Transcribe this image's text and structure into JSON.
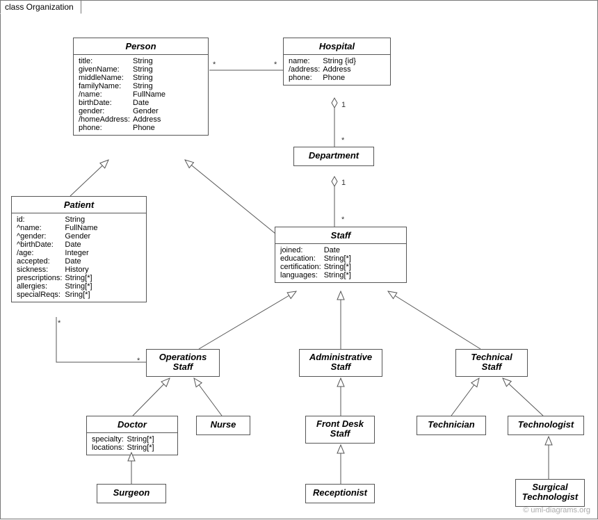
{
  "diagram_title": "class Organization",
  "watermark": "© uml-diagrams.org",
  "classes": {
    "person": {
      "name": "Person",
      "attrs": [
        [
          "title:",
          "String"
        ],
        [
          "givenName:",
          "String"
        ],
        [
          "middleName:",
          "String"
        ],
        [
          "familyName:",
          "String"
        ],
        [
          "/name:",
          "FullName"
        ],
        [
          "birthDate:",
          "Date"
        ],
        [
          "gender:",
          "Gender"
        ],
        [
          "/homeAddress:",
          "Address"
        ],
        [
          "phone:",
          "Phone"
        ]
      ]
    },
    "hospital": {
      "name": "Hospital",
      "attrs": [
        [
          "name:",
          "String {id}"
        ],
        [
          "/address:",
          "Address"
        ],
        [
          "phone:",
          "Phone"
        ]
      ]
    },
    "department": {
      "name": "Department"
    },
    "patient": {
      "name": "Patient",
      "attrs": [
        [
          "id:",
          "String"
        ],
        [
          "^name:",
          "FullName"
        ],
        [
          "^gender:",
          "Gender"
        ],
        [
          "^birthDate:",
          "Date"
        ],
        [
          "/age:",
          "Integer"
        ],
        [
          "accepted:",
          "Date"
        ],
        [
          "sickness:",
          "History"
        ],
        [
          "prescriptions:",
          "String[*]"
        ],
        [
          "allergies:",
          "String[*]"
        ],
        [
          "specialReqs:",
          "Sring[*]"
        ]
      ]
    },
    "staff": {
      "name": "Staff",
      "attrs": [
        [
          "joined:",
          "Date"
        ],
        [
          "education:",
          "String[*]"
        ],
        [
          "certification:",
          "String[*]"
        ],
        [
          "languages:",
          "String[*]"
        ]
      ]
    },
    "operations_staff": {
      "name": "OperationsStaff"
    },
    "administrative_staff": {
      "name": "AdministrativeStaff"
    },
    "technical_staff": {
      "name": "TechnicalStaff"
    },
    "doctor": {
      "name": "Doctor",
      "attrs": [
        [
          "specialty:",
          "String[*]"
        ],
        [
          "locations:",
          "String[*]"
        ]
      ]
    },
    "nurse": {
      "name": "Nurse"
    },
    "front_desk_staff": {
      "name": "Front Desk Staff"
    },
    "technician": {
      "name": "Technician"
    },
    "technologist": {
      "name": "Technologist"
    },
    "surgeon": {
      "name": "Surgeon"
    },
    "receptionist": {
      "name": "Receptionist"
    },
    "surgical_technologist": {
      "name": "SurgicalTechnologist"
    }
  },
  "multiplicities": {
    "person_hospital_left": "*",
    "person_hospital_right": "*",
    "hospital_dept_top": "1",
    "hospital_dept_bottom": "*",
    "dept_staff_top": "1",
    "dept_staff_bottom": "*",
    "patient_ops_left": "*",
    "patient_ops_right": "*"
  }
}
